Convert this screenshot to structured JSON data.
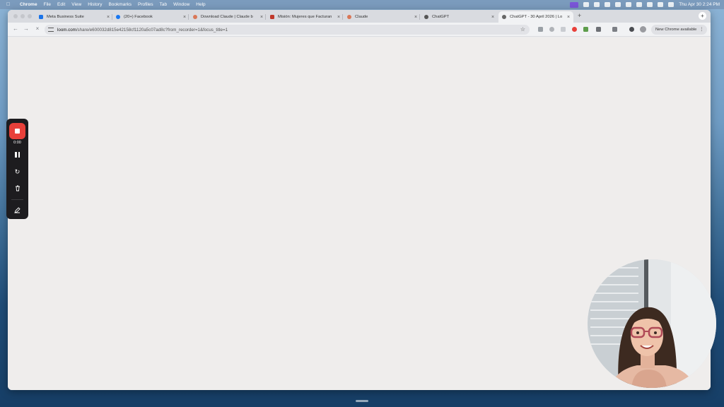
{
  "menubar": {
    "app_name": "Chrome",
    "menus": [
      "File",
      "Edit",
      "View",
      "History",
      "Bookmarks",
      "Profiles",
      "Tab",
      "Window",
      "Help"
    ],
    "clock": "Thu Apr 30  2:24 PM"
  },
  "tabs": [
    {
      "label": "Meta Business Suite",
      "favicon_color": "#1a73e8",
      "active": false
    },
    {
      "label": "(20+) Facebook",
      "favicon_color": "#1877f2",
      "active": false
    },
    {
      "label": "Download Claude | Claude b",
      "favicon_color": "#d97757",
      "active": false
    },
    {
      "label": "Misión: Mujeres que Facturan",
      "favicon_color": "#c0392b",
      "active": false
    },
    {
      "label": "Claude",
      "favicon_color": "#d97757",
      "active": false
    },
    {
      "label": "ChatGPT",
      "favicon_color": "#555555",
      "active": false
    },
    {
      "label": "ChatGPT - 30 April 2026 | Lo",
      "favicon_color": "#666666",
      "active": true
    }
  ],
  "toolbar": {
    "url_host": "loom.com",
    "url_path": "/share/e600032d815e42158cf1120a5c07ad8c?from_recorder=1&focus_title=1",
    "update_label": "New Chrome available",
    "menu_icon": "⋮"
  },
  "loom": {
    "timer": "0:00",
    "stop_icon": "stop-icon",
    "pause_icon": "pause-icon",
    "restart_icon": "restart-icon",
    "delete_icon": "trash-icon",
    "draw_icon": "pen-icon"
  },
  "colors": {
    "accent_record": "#e8403a",
    "loom_bar": "#1d1c1f",
    "content_bg": "#efedec"
  }
}
